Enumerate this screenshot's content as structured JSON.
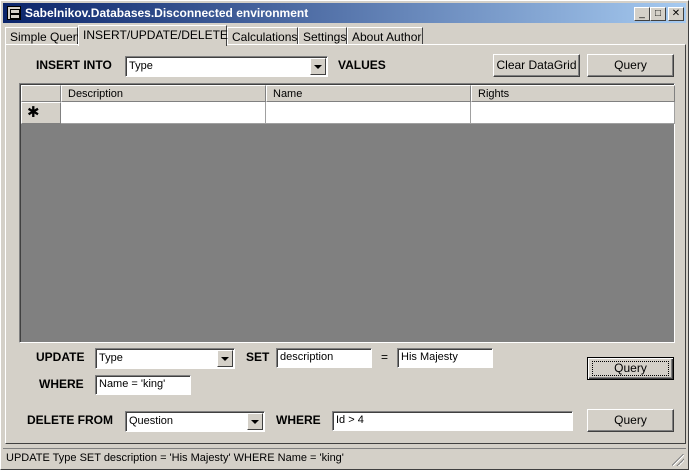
{
  "window": {
    "title": "Sabelnikov.Databases.Disconnected environment",
    "controls": {
      "minimize": "_",
      "maximize": "□",
      "close": "✕"
    }
  },
  "tabs": [
    {
      "label": "Simple Query",
      "active": false
    },
    {
      "label": "INSERT/UPDATE/DELETE",
      "active": true
    },
    {
      "label": "Calculations",
      "active": false
    },
    {
      "label": "Settings",
      "active": false
    },
    {
      "label": "About Author",
      "active": false
    }
  ],
  "insert": {
    "label": "INSERT INTO",
    "table_value": "Type",
    "values_label": "VALUES",
    "clear_button": "Clear DataGrid",
    "query_button": "Query"
  },
  "grid": {
    "columns": [
      "Description",
      "Name",
      "Rights"
    ],
    "new_row_marker": "✱"
  },
  "update": {
    "label": "UPDATE",
    "table_value": "Type",
    "set_label": "SET",
    "set_field": "description",
    "equals": "=",
    "set_value": "His Majesty",
    "where_label": "WHERE",
    "where_value": "Name = 'king'",
    "query_button": "Query"
  },
  "delete": {
    "label": "DELETE FROM",
    "table_value": "Question",
    "where_label": "WHERE",
    "where_value": "Id > 4",
    "query_button": "Query"
  },
  "status": {
    "text": "UPDATE Type SET description = 'His Majesty' WHERE Name = 'king'"
  }
}
